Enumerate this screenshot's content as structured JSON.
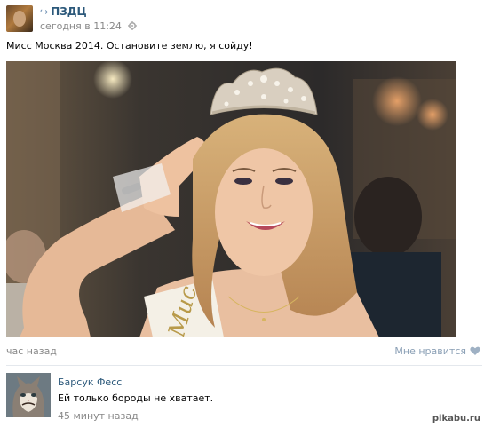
{
  "post": {
    "group_name": "ПЗДЦ",
    "time": "сегодня в 11:24",
    "text": "Мисс Москва 2014. Остановите землю, я сойду!",
    "photo_sash_text": "Мис",
    "footer_time": "час назад",
    "like_label": "Мне нравится"
  },
  "comment": {
    "author": "Барсук Фесс",
    "text": "Ей только бороды не хватает.",
    "time": "45 минут назад"
  },
  "watermark": "pikabu.ru",
  "colors": {
    "link": "#2b587a",
    "muted": "#888888",
    "like": "#8a9fb5"
  },
  "icons": [
    "repost-icon",
    "gear-icon",
    "heart-icon"
  ]
}
